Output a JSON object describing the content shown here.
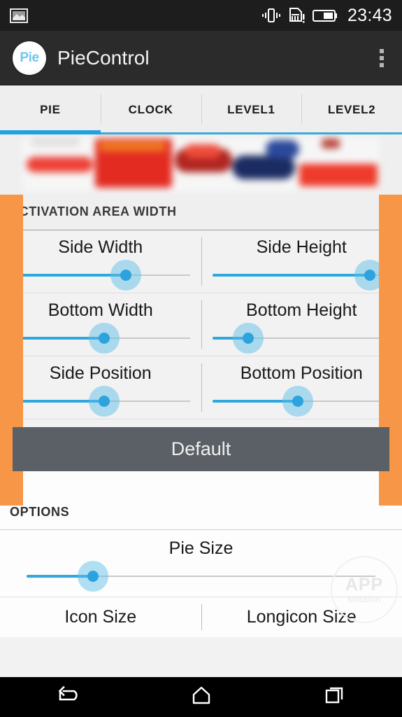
{
  "status_bar": {
    "clock": "23:43",
    "icons": {
      "screenshot": "image-icon",
      "vibrate": "vibrate-icon",
      "sim_warning": "sim-card-warning-icon",
      "battery": "battery-icon"
    }
  },
  "action_bar": {
    "app_icon_text": "Pie",
    "title": "PieControl",
    "overflow": "overflow-menu-icon"
  },
  "tabs": [
    {
      "label": "PIE",
      "selected": true
    },
    {
      "label": "CLOCK",
      "selected": false
    },
    {
      "label": "LEVEL1",
      "selected": false
    },
    {
      "label": "LEVEL2",
      "selected": false
    }
  ],
  "ad_banner": {
    "name": "ad-banner",
    "content": "blurred advertisement image"
  },
  "sections": [
    {
      "header": "ACTIVATION AREA WIDTH",
      "rows": [
        [
          {
            "label": "Side Width",
            "value": 64
          },
          {
            "label": "Side Height",
            "value": 88
          }
        ],
        [
          {
            "label": "Bottom Width",
            "value": 52
          },
          {
            "label": "Bottom Height",
            "value": 20
          }
        ],
        [
          {
            "label": "Side Position",
            "value": 52
          },
          {
            "label": "Bottom Position",
            "value": 48
          }
        ]
      ],
      "button": "Default"
    },
    {
      "header": "OPTIONS",
      "wide_rows": [
        {
          "label": "Pie Size",
          "value": 19
        }
      ],
      "rows": [
        [
          {
            "label": "Icon Size"
          },
          {
            "label": "Longicon Size"
          }
        ]
      ]
    }
  ],
  "watermark": {
    "top": "APP",
    "bottom": "solution"
  },
  "nav_bar": {
    "back": "back-icon",
    "home": "home-icon",
    "recents": "recents-icon"
  },
  "colors": {
    "accent_blue": "#30a8de",
    "orange": "#f79646",
    "action_bar": "#2b2b2b",
    "button_gray": "#5b6066"
  }
}
